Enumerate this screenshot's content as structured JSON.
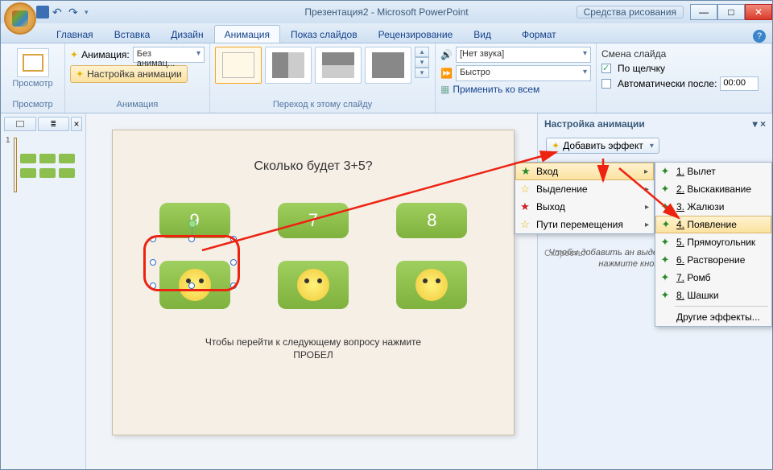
{
  "title": {
    "doc": "Презентация2",
    "app": "Microsoft PowerPoint",
    "context": "Средства рисования"
  },
  "tabs": {
    "home": "Главная",
    "insert": "Вставка",
    "design": "Дизайн",
    "anim": "Анимация",
    "show": "Показ слайдов",
    "review": "Рецензирование",
    "view": "Вид",
    "format": "Формат"
  },
  "ribbon": {
    "preview": {
      "group": "Просмотр",
      "btn": "Просмотр"
    },
    "anim": {
      "group": "Анимация",
      "label": "Анимация:",
      "value": "Без анимац...",
      "setup": "Настройка анимации"
    },
    "transitions": {
      "group": "Переход к этому слайду"
    },
    "sound": {
      "sound_label": "",
      "sound_value": "[Нет звука]",
      "speed_value": "Быстро",
      "apply_all": "Применить ко всем"
    },
    "advance": {
      "group": "Смена слайда",
      "onclick": "По щелчку",
      "auto": "Автоматически после:",
      "time": "00:00"
    }
  },
  "slide": {
    "question": "Сколько будет 3+5?",
    "cards": [
      "9",
      "7",
      "8"
    ],
    "hint1": "Чтобы перейти к следующему вопросу нажмите",
    "hint2": "ПРОБЕЛ"
  },
  "taskpane": {
    "title": "Настройка анимации",
    "add": "Добавить эффект",
    "speed": "Скорость:",
    "hint": "Чтобы добавить ан\nвыделите элемент на\nзатем нажмите кнопку\nэффект\"."
  },
  "menu1": {
    "items": [
      {
        "label": "Вход",
        "star": "g",
        "sub": true,
        "hl": true
      },
      {
        "label": "Выделение",
        "star": "y",
        "sub": true
      },
      {
        "label": "Выход",
        "star": "r",
        "sub": true
      },
      {
        "label": "Пути перемещения",
        "star": "y",
        "sub": true
      }
    ]
  },
  "menu2": {
    "items": [
      {
        "num": "1.",
        "label": "Вылет"
      },
      {
        "num": "2.",
        "label": "Выскакивание"
      },
      {
        "num": "3.",
        "label": "Жалюзи"
      },
      {
        "num": "4.",
        "label": "Появление",
        "hl": true
      },
      {
        "num": "5.",
        "label": "Прямоугольник"
      },
      {
        "num": "6.",
        "label": "Растворение"
      },
      {
        "num": "7.",
        "label": "Ромб"
      },
      {
        "num": "8.",
        "label": "Шашки"
      }
    ],
    "other": "Другие эффекты..."
  },
  "chart_data": null
}
